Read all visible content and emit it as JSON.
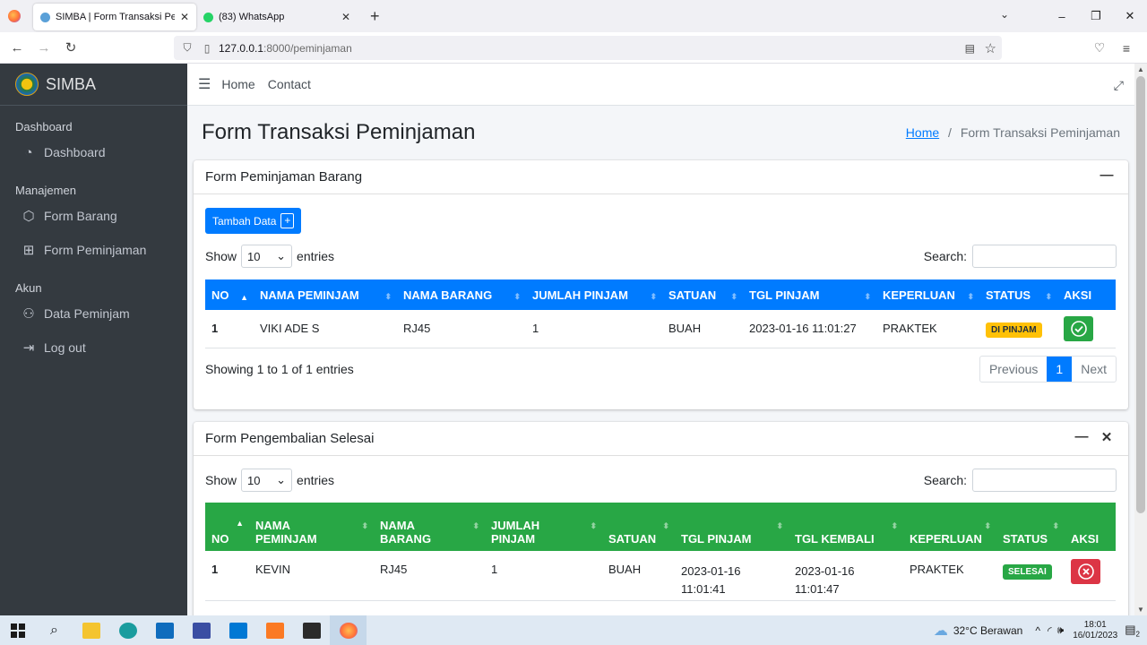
{
  "browser": {
    "tabs": [
      {
        "title": "SIMBA | Form Transaksi Peminjaman",
        "active": true
      },
      {
        "title": "(83) WhatsApp",
        "active": false
      }
    ],
    "url_host": "127.0.0.1",
    "url_path": ":8000/peminjaman"
  },
  "sidebar": {
    "brand": "SIMBA",
    "sections": [
      {
        "header": "Dashboard",
        "items": [
          {
            "label": "Dashboard",
            "icon": "tachometer-icon"
          }
        ]
      },
      {
        "header": "Manajemen",
        "items": [
          {
            "label": "Form Barang",
            "icon": "box-icon"
          },
          {
            "label": "Form Peminjaman",
            "icon": "file-plus-icon"
          }
        ]
      },
      {
        "header": "Akun",
        "items": [
          {
            "label": "Data Peminjam",
            "icon": "user-icon"
          },
          {
            "label": "Log out",
            "icon": "logout-icon"
          }
        ]
      }
    ]
  },
  "topnav": {
    "home": "Home",
    "contact": "Contact"
  },
  "page": {
    "title": "Form Transaksi Peminjaman",
    "breadcrumb_home": "Home",
    "breadcrumb_sep": "/",
    "breadcrumb_current": "Form Transaksi Peminjaman"
  },
  "card1": {
    "title": "Form Peminjaman Barang",
    "add_button": "Tambah Data",
    "show": "Show",
    "entries_value": "10",
    "entries": "entries",
    "search": "Search:",
    "columns": [
      "NO",
      "NAMA PEMINJAM",
      "NAMA BARANG",
      "JUMLAH PINJAM",
      "SATUAN",
      "TGL PINJAM",
      "KEPERLUAN",
      "STATUS",
      "AKSI"
    ],
    "rows": [
      {
        "no": "1",
        "peminjam": "VIKI ADE S",
        "barang": "RJ45",
        "jumlah": "1",
        "satuan": "BUAH",
        "tgl_pinjam": "2023-01-16 11:01:27",
        "keperluan": "PRAKTEK",
        "status": "DI PINJAM"
      }
    ],
    "info": "Showing 1 to 1 of 1 entries",
    "prev": "Previous",
    "page": "1",
    "next": "Next"
  },
  "card2": {
    "title": "Form Pengembalian Selesai",
    "show": "Show",
    "entries_value": "10",
    "entries": "entries",
    "search": "Search:",
    "columns": [
      "NO",
      "NAMA PEMINJAM",
      "NAMA BARANG",
      "JUMLAH PINJAM",
      "SATUAN",
      "TGL PINJAM",
      "TGL KEMBALI",
      "KEPERLUAN",
      "STATUS",
      "AKSI"
    ],
    "rows": [
      {
        "no": "1",
        "peminjam": "KEVIN",
        "barang": "RJ45",
        "jumlah": "1",
        "satuan": "BUAH",
        "tgl_pinjam": "2023-01-16 11:01:41",
        "tgl_kembali": "2023-01-16 11:01:47",
        "keperluan": "PRAKTEK",
        "status": "SELESAI"
      }
    ]
  },
  "taskbar": {
    "weather": "32°C  Berawan",
    "time": "18:01",
    "date": "16/01/2023",
    "notif": "2"
  },
  "colors": {
    "primary": "#007bff",
    "success": "#28a745",
    "warning": "#ffc107",
    "danger": "#dc3545",
    "sidebar": "#343a40"
  }
}
